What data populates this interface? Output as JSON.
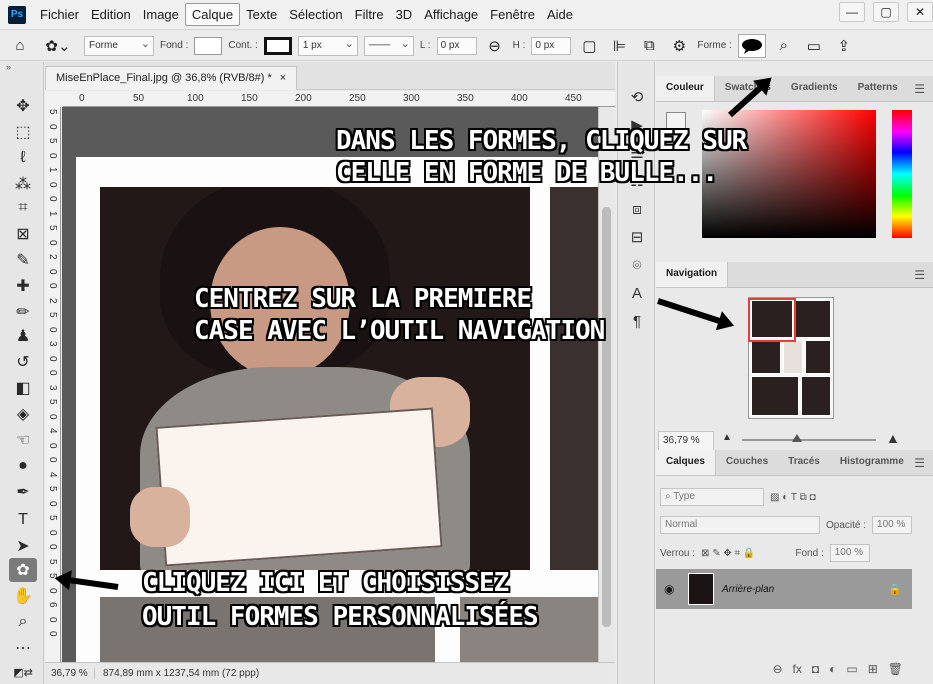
{
  "menu": {
    "items": [
      "Fichier",
      "Edition",
      "Image",
      "Calque",
      "Texte",
      "Sélection",
      "Filtre",
      "3D",
      "Affichage",
      "Fenêtre",
      "Aide"
    ],
    "active": "Calque"
  },
  "options": {
    "mode": "Forme",
    "fill_label": "Fond :",
    "stroke_label": "Cont. :",
    "stroke_width": "1 px",
    "w_label": "L :",
    "w_value": "0 px",
    "h_label": "H :",
    "h_value": "0 px",
    "shape_label": "Forme :"
  },
  "document": {
    "tab_title": "MiseEnPlace_Final.jpg @ 36,8% (RVB/8#) *",
    "close": "×",
    "ruler_h": [
      "0",
      "50",
      "100",
      "150",
      "200",
      "250",
      "300",
      "350",
      "400",
      "450"
    ],
    "ruler_v": [
      "5",
      "0",
      "5",
      "0",
      "1",
      "0",
      "0",
      "1",
      "5",
      "0",
      "2",
      "0",
      "0",
      "2",
      "5",
      "0",
      "3",
      "0",
      "0",
      "3",
      "5",
      "0",
      "4",
      "0",
      "0",
      "4",
      "5",
      "0",
      "5",
      "0",
      "0",
      "5",
      "5",
      "0",
      "6",
      "0",
      "0"
    ]
  },
  "status": {
    "zoom": "36,79 %",
    "info": "874,89 mm x 1237,54 mm (72 ppp)"
  },
  "panels": {
    "color_tabs": [
      "Couleur",
      "Swatches",
      "Gradients",
      "Patterns"
    ],
    "navigation_tab": "Navigation",
    "nav_zoom": "36,79 %",
    "layer_tabs": [
      "Calques",
      "Couches",
      "Tracés",
      "Histogramme"
    ],
    "filter_type": "Type",
    "blend_mode": "Normal",
    "opacity_label": "Opacité :",
    "opacity_value": "100 %",
    "lock_label": "Verrou :",
    "fill_label": "Fond :",
    "fill_value": "100 %",
    "layer_name": "Arrière-plan"
  },
  "annotations": {
    "shapes_line1": "DANS LES FORMES, CLIQUEZ SUR",
    "shapes_line2": "CELLE EN FORME DE BULLE...",
    "nav_line1": "CENTREZ SUR LA PREMIERE",
    "nav_line2": "CASE AVEC L’OUTIL NAVIGATION",
    "tool_line1": "CLIQUEZ ICI ET CHOISISSEZ",
    "tool_line2": "OUTIL FORMES PERSONNALISÉES"
  },
  "colors": {
    "nav_highlight": "#e0403a",
    "ps_logo_bg": "#001e36",
    "ps_logo_fg": "#31a8ff"
  }
}
